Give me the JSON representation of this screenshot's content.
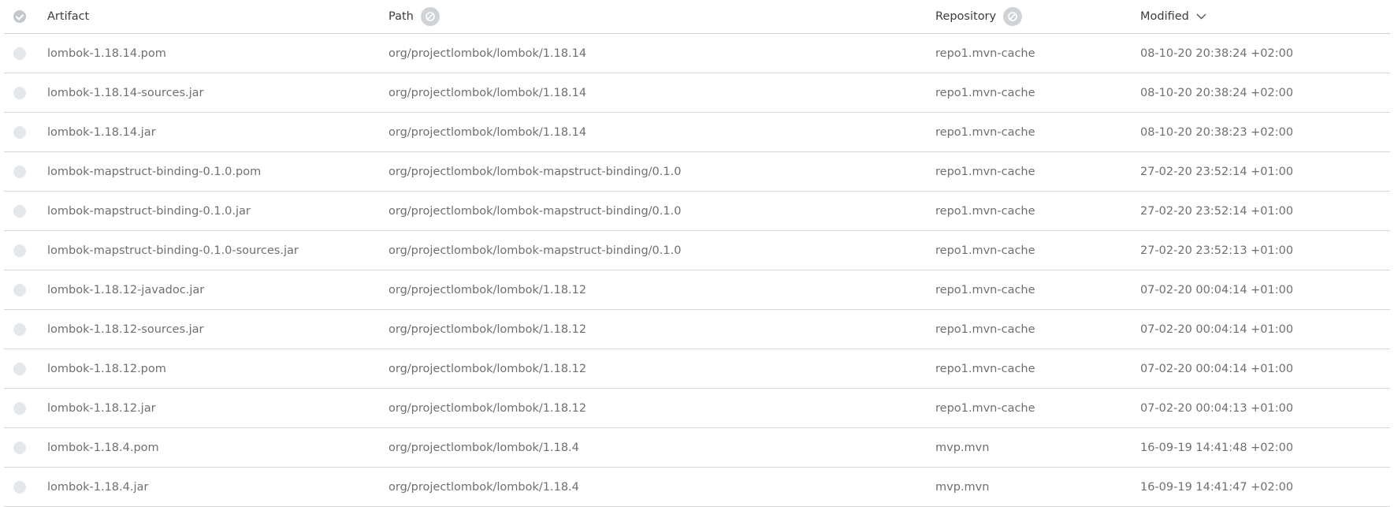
{
  "table": {
    "columns": {
      "artifact": "Artifact",
      "path": "Path",
      "repository": "Repository",
      "modified": "Modified"
    },
    "rows": [
      {
        "artifact": "lombok-1.18.14.pom",
        "path": "org/projectlombok/lombok/1.18.14",
        "repository": "repo1.mvn-cache",
        "modified": "08-10-20 20:38:24 +02:00"
      },
      {
        "artifact": "lombok-1.18.14-sources.jar",
        "path": "org/projectlombok/lombok/1.18.14",
        "repository": "repo1.mvn-cache",
        "modified": "08-10-20 20:38:24 +02:00"
      },
      {
        "artifact": "lombok-1.18.14.jar",
        "path": "org/projectlombok/lombok/1.18.14",
        "repository": "repo1.mvn-cache",
        "modified": "08-10-20 20:38:23 +02:00"
      },
      {
        "artifact": "lombok-mapstruct-binding-0.1.0.pom",
        "path": "org/projectlombok/lombok-mapstruct-binding/0.1.0",
        "repository": "repo1.mvn-cache",
        "modified": "27-02-20 23:52:14 +01:00"
      },
      {
        "artifact": "lombok-mapstruct-binding-0.1.0.jar",
        "path": "org/projectlombok/lombok-mapstruct-binding/0.1.0",
        "repository": "repo1.mvn-cache",
        "modified": "27-02-20 23:52:14 +01:00"
      },
      {
        "artifact": "lombok-mapstruct-binding-0.1.0-sources.jar",
        "path": "org/projectlombok/lombok-mapstruct-binding/0.1.0",
        "repository": "repo1.mvn-cache",
        "modified": "27-02-20 23:52:13 +01:00"
      },
      {
        "artifact": "lombok-1.18.12-javadoc.jar",
        "path": "org/projectlombok/lombok/1.18.12",
        "repository": "repo1.mvn-cache",
        "modified": "07-02-20 00:04:14 +01:00"
      },
      {
        "artifact": "lombok-1.18.12-sources.jar",
        "path": "org/projectlombok/lombok/1.18.12",
        "repository": "repo1.mvn-cache",
        "modified": "07-02-20 00:04:14 +01:00"
      },
      {
        "artifact": "lombok-1.18.12.pom",
        "path": "org/projectlombok/lombok/1.18.12",
        "repository": "repo1.mvn-cache",
        "modified": "07-02-20 00:04:14 +01:00"
      },
      {
        "artifact": "lombok-1.18.12.jar",
        "path": "org/projectlombok/lombok/1.18.12",
        "repository": "repo1.mvn-cache",
        "modified": "07-02-20 00:04:13 +01:00"
      },
      {
        "artifact": "lombok-1.18.4.pom",
        "path": "org/projectlombok/lombok/1.18.4",
        "repository": "mvp.mvn",
        "modified": "16-09-19 14:41:48 +02:00"
      },
      {
        "artifact": "lombok-1.18.4.jar",
        "path": "org/projectlombok/lombok/1.18.4",
        "repository": "mvp.mvn",
        "modified": "16-09-19 14:41:47 +02:00"
      }
    ]
  }
}
